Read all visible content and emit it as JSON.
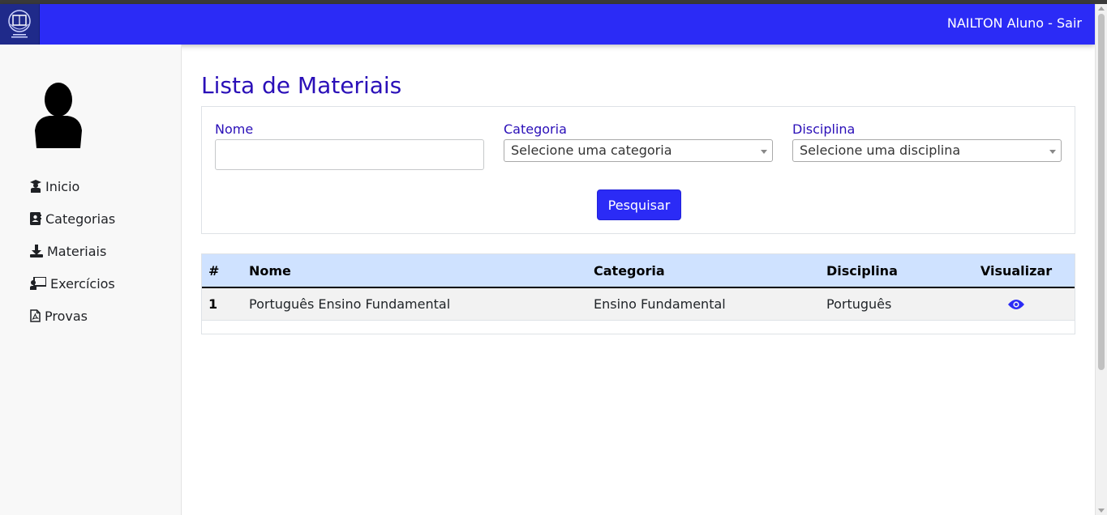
{
  "navbar": {
    "user_link": "NAILTON Aluno - Sair",
    "color": "#2b2bf6"
  },
  "sidebar": {
    "avatar_icon": "user-silhouette-icon",
    "items": [
      {
        "label": "Inicio",
        "icon": "teacher-icon"
      },
      {
        "label": "Categorias",
        "icon": "address-book-icon"
      },
      {
        "label": "Materiais",
        "icon": "download-icon"
      },
      {
        "label": "Exercícios",
        "icon": "chalkboard-user-icon"
      },
      {
        "label": "Provas",
        "icon": "file-pdf-icon"
      }
    ]
  },
  "main": {
    "title": "Lista de Materiais",
    "filters": {
      "nome_label": "Nome",
      "nome_value": "",
      "categoria_label": "Categoria",
      "categoria_selected": "Selecione uma categoria",
      "disciplina_label": "Disciplina",
      "disciplina_selected": "Selecione uma disciplina",
      "search_button": "Pesquisar"
    },
    "table": {
      "headers": [
        "#",
        "Nome",
        "Categoria",
        "Disciplina",
        "Visualizar"
      ],
      "rows": [
        {
          "num": "1",
          "nome": "Português Ensino Fundamental",
          "categoria": "Ensino Fundamental",
          "disciplina": "Português",
          "action_icon": "eye-icon"
        }
      ]
    }
  },
  "colors": {
    "accent": "#2b2bf6",
    "title": "#2a0fb8",
    "table_header_bg": "#cfe2ff"
  }
}
